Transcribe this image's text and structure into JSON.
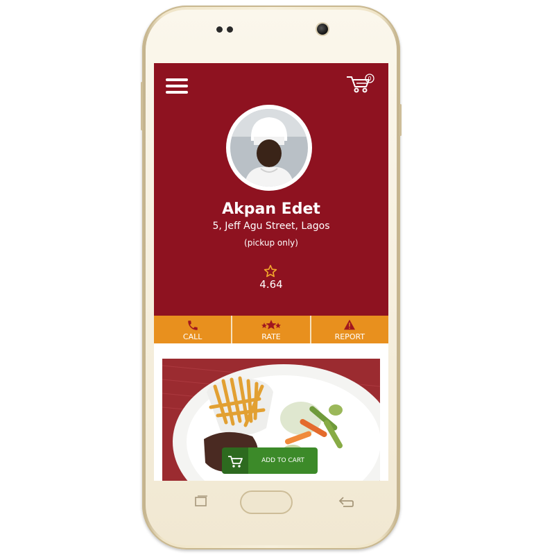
{
  "header": {
    "menu_icon": "hamburger-icon",
    "cart_icon": "cart-icon",
    "cart_count": "0"
  },
  "profile": {
    "name": "Akpan Edet",
    "address": "5, Jeff Agu Street, Lagos",
    "note": "(pickup only)",
    "rating": "4.64",
    "rating_icon": "star-outline-icon"
  },
  "actions": [
    {
      "label": "CALL",
      "icon": "phone-icon"
    },
    {
      "label": "RATE",
      "icon": "star-badge-icon"
    },
    {
      "label": "REPORT",
      "icon": "warning-icon"
    }
  ],
  "item": {
    "add_to_cart_label": "ADD TO CART",
    "add_to_cart_icon": "cart-icon"
  },
  "colors": {
    "primary": "#8e1220",
    "accent": "#e8901e",
    "cart_button": "#3c8a29",
    "cart_button_dark": "#2d6a1f"
  },
  "device": {
    "recent_apps_icon": "recent-apps-icon",
    "back_icon": "back-icon"
  }
}
